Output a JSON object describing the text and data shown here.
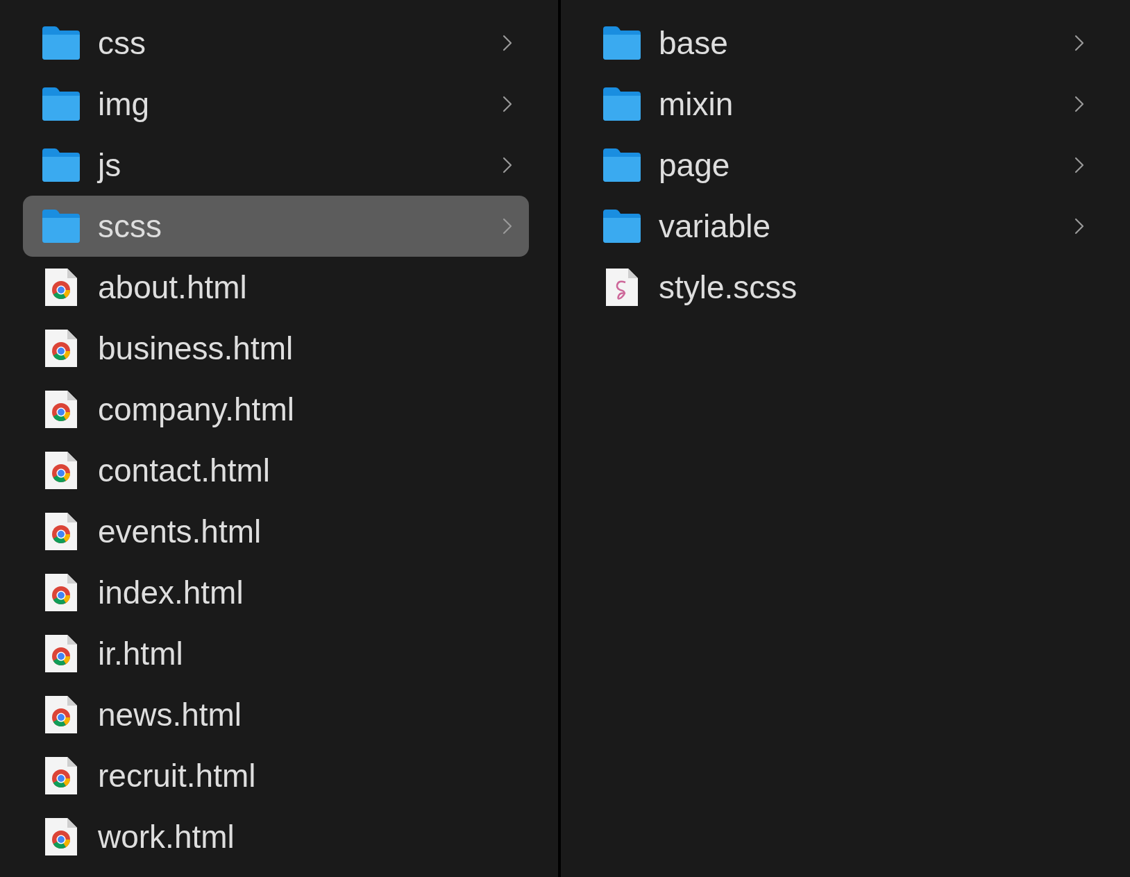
{
  "columns": [
    {
      "items": [
        {
          "name": "css",
          "kind": "folder",
          "selected": false
        },
        {
          "name": "img",
          "kind": "folder",
          "selected": false
        },
        {
          "name": "js",
          "kind": "folder",
          "selected": false
        },
        {
          "name": "scss",
          "kind": "folder",
          "selected": true
        },
        {
          "name": "about.html",
          "kind": "html",
          "selected": false
        },
        {
          "name": "business.html",
          "kind": "html",
          "selected": false
        },
        {
          "name": "company.html",
          "kind": "html",
          "selected": false
        },
        {
          "name": "contact.html",
          "kind": "html",
          "selected": false
        },
        {
          "name": "events.html",
          "kind": "html",
          "selected": false
        },
        {
          "name": "index.html",
          "kind": "html",
          "selected": false
        },
        {
          "name": "ir.html",
          "kind": "html",
          "selected": false
        },
        {
          "name": "news.html",
          "kind": "html",
          "selected": false
        },
        {
          "name": "recruit.html",
          "kind": "html",
          "selected": false
        },
        {
          "name": "work.html",
          "kind": "html",
          "selected": false
        }
      ]
    },
    {
      "items": [
        {
          "name": "base",
          "kind": "folder",
          "selected": false
        },
        {
          "name": "mixin",
          "kind": "folder",
          "selected": false
        },
        {
          "name": "page",
          "kind": "folder",
          "selected": false
        },
        {
          "name": "variable",
          "kind": "folder",
          "selected": false
        },
        {
          "name": "style.scss",
          "kind": "scss",
          "selected": false
        }
      ]
    }
  ]
}
